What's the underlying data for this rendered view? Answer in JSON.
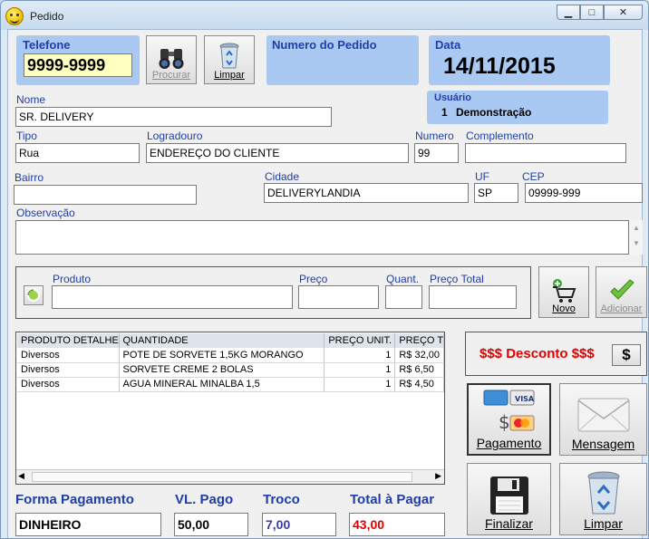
{
  "window": {
    "title": "Pedido"
  },
  "phone": {
    "label": "Telefone",
    "value": "9999-9999"
  },
  "buttons": {
    "search": "Procurar",
    "clear": "Limpar",
    "new": "Novo",
    "add": "Adicionar",
    "discount_btn": "$",
    "payment": "Pagamento",
    "message": "Mensagem",
    "finish": "Finalizar",
    "clear_big": "Limpar"
  },
  "order": {
    "label": "Numero do Pedido",
    "value": ""
  },
  "date": {
    "label": "Data",
    "value": "14/11/2015"
  },
  "user": {
    "label": "Usuário",
    "id": "1",
    "name": "Demonstração"
  },
  "customer": {
    "name_label": "Nome",
    "name": "SR. DELIVERY",
    "type_label": "Tipo",
    "type": "Rua",
    "street_label": "Logradouro",
    "street": "ENDEREÇO DO CLIENTE",
    "number_label": "Numero",
    "number": "99",
    "complement_label": "Complemento",
    "complement": "",
    "district_label": "Bairro",
    "district": "",
    "city_label": "Cidade",
    "city": "DELIVERYLANDIA",
    "state_label": "UF",
    "state": "SP",
    "zip_label": "CEP",
    "zip": "09999-999",
    "notes_label": "Observação",
    "notes": ""
  },
  "product_entry": {
    "product_label": "Produto",
    "price_label": "Preço",
    "qty_label": "Quant.",
    "total_label": "Preço Total",
    "product": "",
    "price": "",
    "qty": "",
    "total": ""
  },
  "items_table": {
    "columns": [
      "PRODUTO DETALHES",
      "QUANTIDADE",
      "PREÇO UNIT.",
      "PREÇO T"
    ],
    "rows": [
      [
        "Diversos",
        "POTE DE SORVETE 1,5KG MORANGO",
        "1",
        "R$ 32,00"
      ],
      [
        "Diversos",
        "SORVETE CREME 2 BOLAS",
        "1",
        "R$ 6,50"
      ],
      [
        "Diversos",
        "AGUA MINERAL MINALBA 1,5",
        "1",
        "R$ 4,50"
      ]
    ]
  },
  "discount": {
    "label": "$$$ Desconto $$$"
  },
  "totals": {
    "payment_method_label": "Forma Pagamento",
    "payment_method": "DINHEIRO",
    "paid_label": "VL. Pago",
    "paid": "50,00",
    "change_label": "Troco",
    "change": "7,00",
    "total_label": "Total à Pagar",
    "total": "43,00"
  },
  "colors": {
    "panel": "#a9c9f3",
    "label": "#1f3ea8",
    "discount": "#e00000",
    "phone_bg": "#ffffc0"
  },
  "icons": [
    "binoculars-icon",
    "recycle-bin-icon",
    "refresh-icon",
    "cart-add-icon",
    "checkmark-icon",
    "credit-cards-icon",
    "envelope-icon",
    "floppy-disk-icon"
  ]
}
